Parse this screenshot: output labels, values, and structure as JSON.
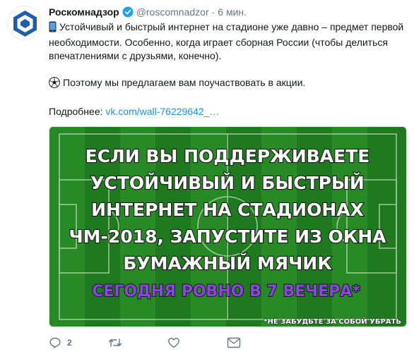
{
  "tweet": {
    "author_name": "Роскомнадзор",
    "handle": "@roscomnadzor",
    "separator": "·",
    "time": "6 мин.",
    "lines": {
      "p1": "Устойчивый и быстрый интернет на стадионе уже давно – предмет первой необходимости. Особенно, когда играет сборная России (чтобы делиться впечатлениями с друзьями, конечно).",
      "p2": "Поэтому мы предлагаем вам поучаствовать в акции.",
      "more_label": "Подробнее:",
      "link": "vk.com/wall-76229642_…"
    }
  },
  "media": {
    "headline_lines": [
      "ЕСЛИ ВЫ ПОДДЕРЖИВАЕТЕ",
      "УСТОЙЧИВЫЙ И БЫСТРЫЙ",
      "ИНТЕРНЕТ НА СТАДИОНАХ",
      "ЧМ-2018, ЗАПУСТИТЕ ИЗ ОКНА",
      "БУМАЖНЫЙ МЯЧИК"
    ],
    "highlight": "СЕГОДНЯ РОВНО В 7 ВЕЧЕРА*",
    "footnote": "*НЕ ЗАБУДЬТЕ ЗА СОБОЙ УБРАТЬ",
    "colors": {
      "grass_dark": "#1f7a1f",
      "grass_light": "#2f9a2c",
      "highlight": "#7a3bd6"
    }
  },
  "actions": {
    "reply_count": "2",
    "retweet_count": "",
    "like_count": ""
  },
  "icons": [
    "verified-icon",
    "phone-icon",
    "soccer-ball-icon",
    "reply-icon",
    "retweet-icon",
    "like-icon",
    "message-icon"
  ]
}
